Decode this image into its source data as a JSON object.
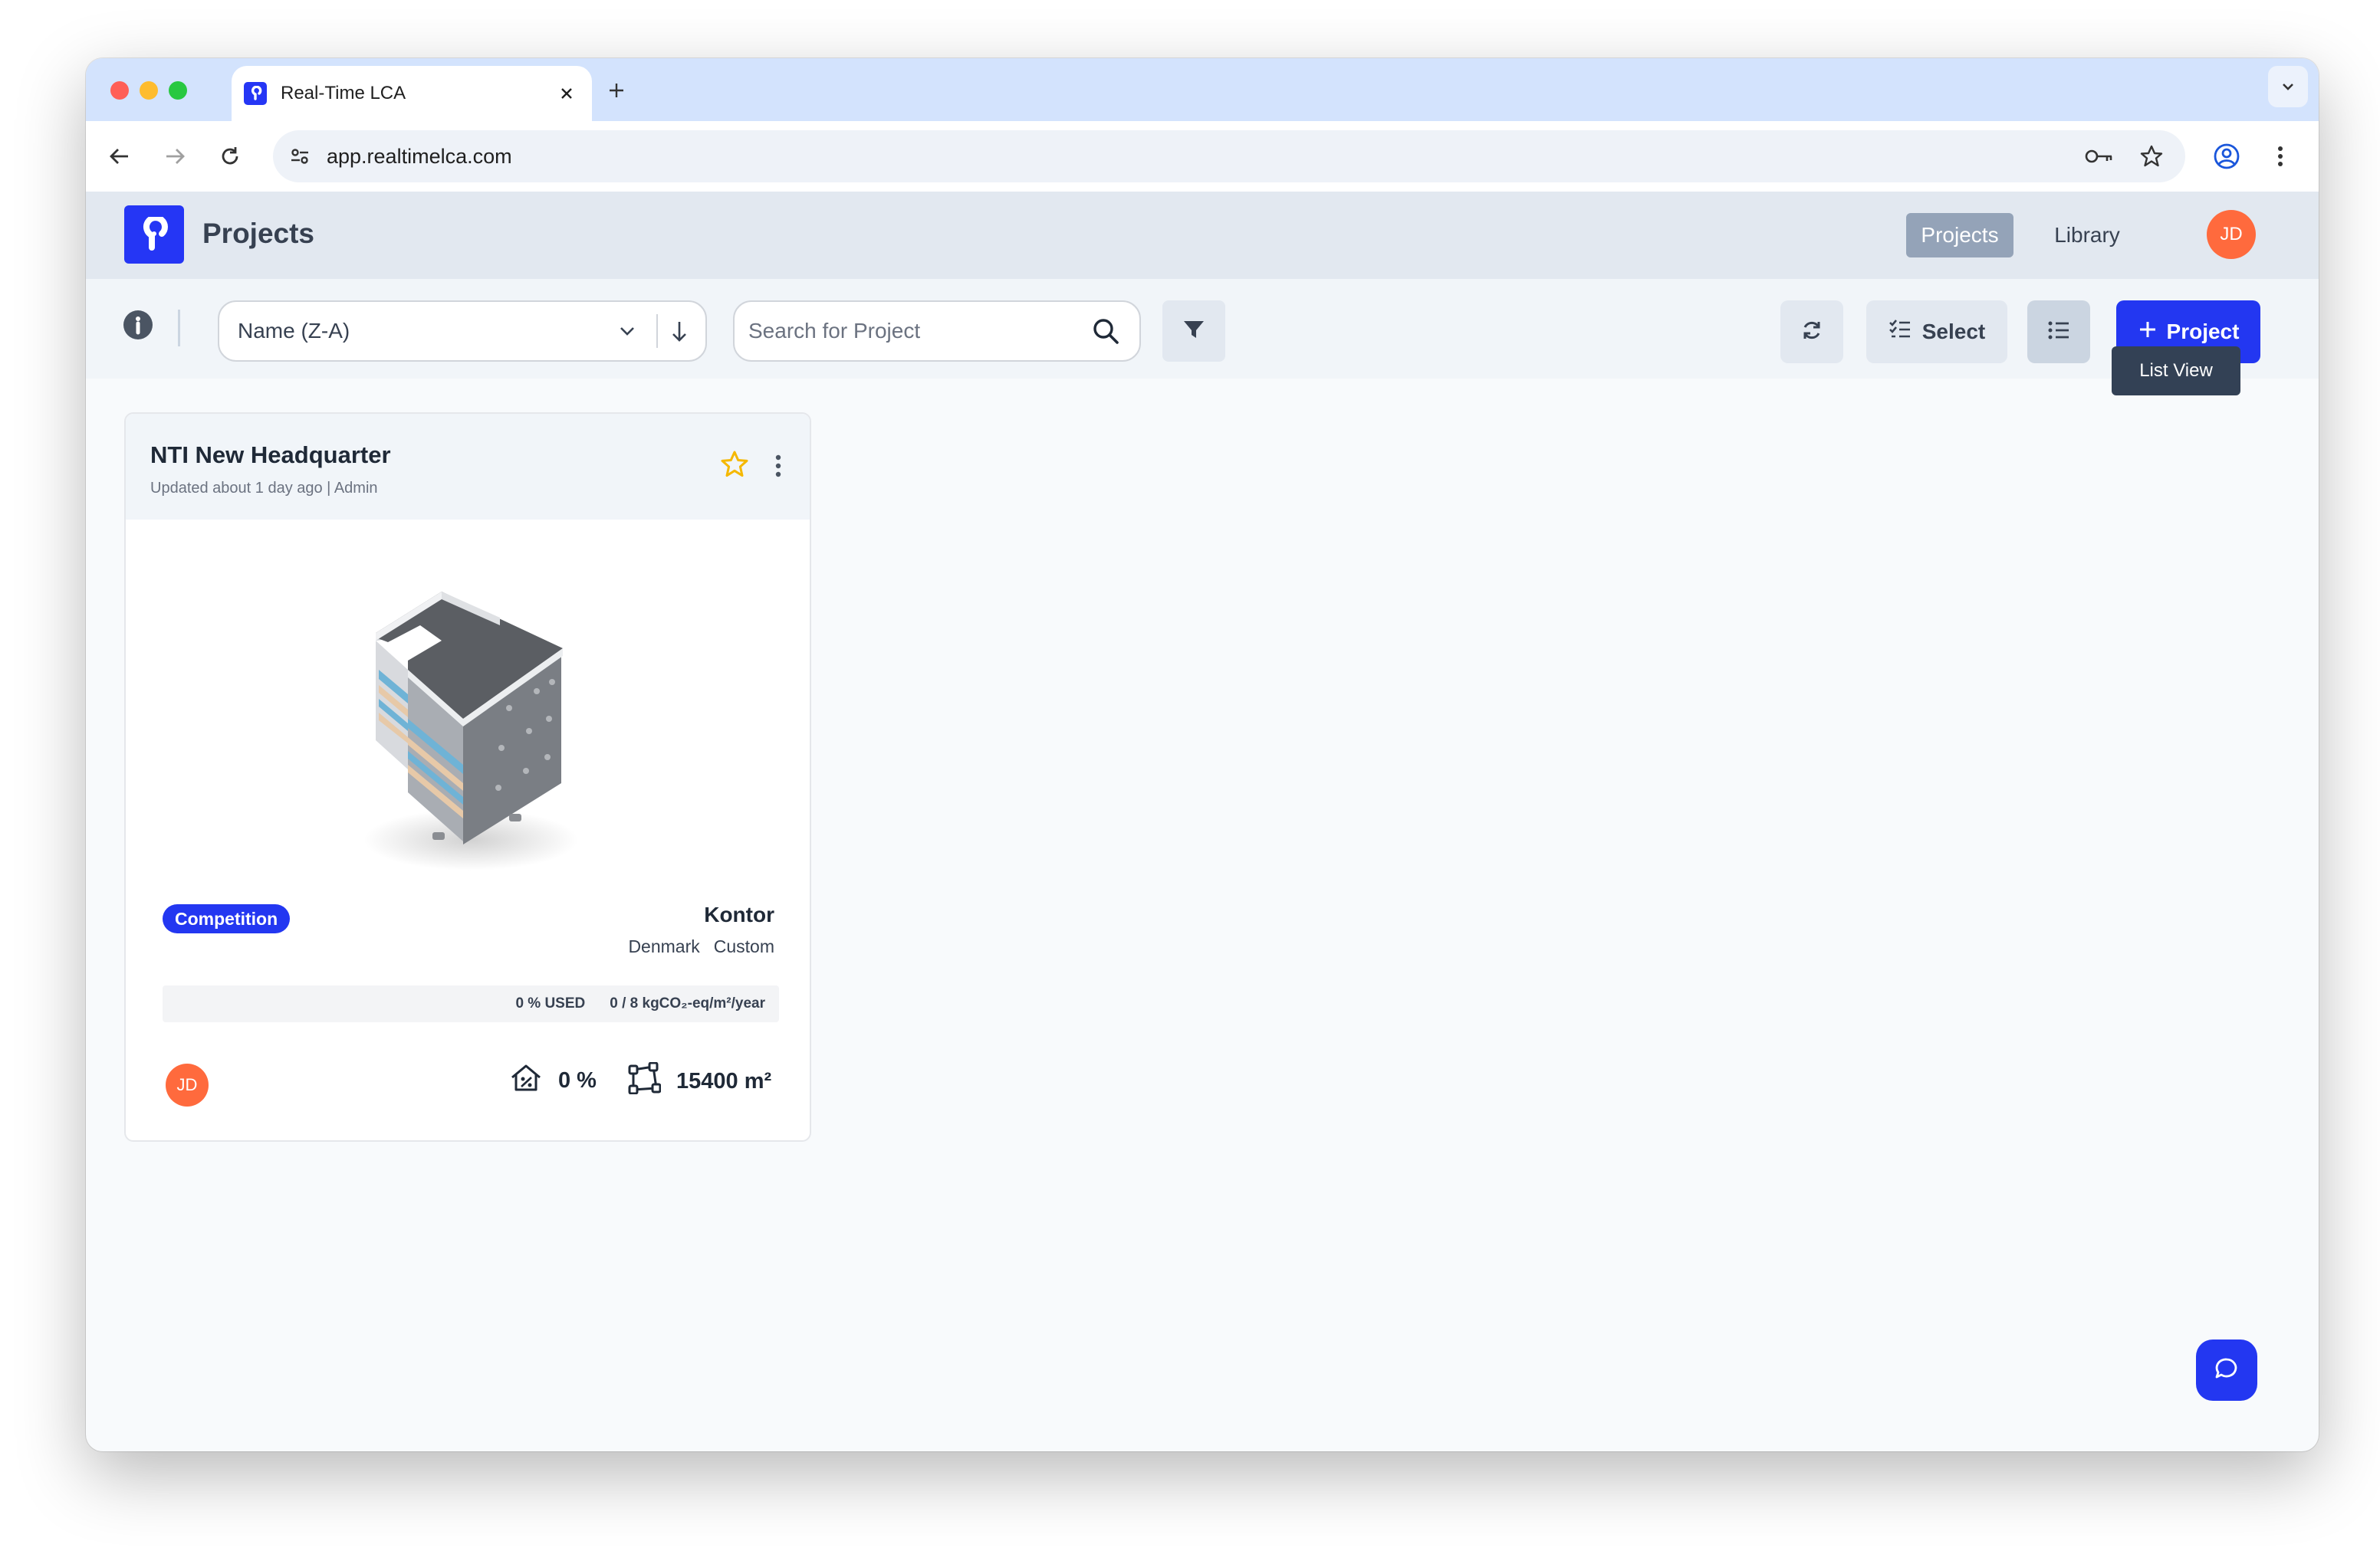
{
  "browser": {
    "tab_title": "Real-Time LCA",
    "url": "app.realtimelca.com"
  },
  "app": {
    "title": "Projects",
    "nav": {
      "projects": "Projects",
      "library": "Library"
    },
    "user_initials": "JD"
  },
  "filters": {
    "sort_label": "Name (Z-A)",
    "search_placeholder": "Search for Project",
    "select_label": "Select",
    "add_label": "Project",
    "tooltip": "List View"
  },
  "project": {
    "title": "NTI New Headquarter",
    "meta": "Updated about 1 day ago | Admin",
    "badge": "Competition",
    "building_type": "Kontor",
    "country": "Denmark",
    "standard": "Custom",
    "usage_text": "0 % USED",
    "budget_text": "0 / 8 kgCO₂-eq/m²/year",
    "owner_initials": "JD",
    "completion": "0 %",
    "area": "15400 m²"
  },
  "colors": {
    "brand": "#2337f1",
    "avatar": "#ff6a3d",
    "star": "#f5b800"
  }
}
